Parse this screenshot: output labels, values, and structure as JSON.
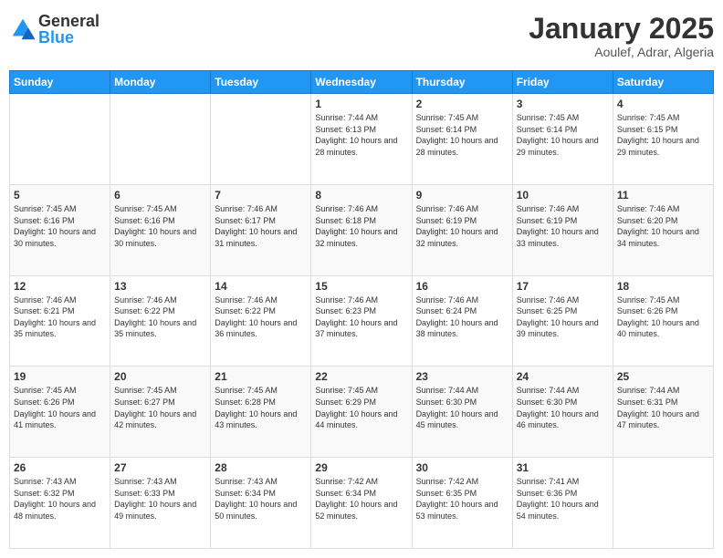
{
  "header": {
    "logo_general": "General",
    "logo_blue": "Blue",
    "month_title": "January 2025",
    "subtitle": "Aoulef, Adrar, Algeria"
  },
  "weekdays": [
    "Sunday",
    "Monday",
    "Tuesday",
    "Wednesday",
    "Thursday",
    "Friday",
    "Saturday"
  ],
  "weeks": [
    [
      {
        "day": "",
        "sunrise": "",
        "sunset": "",
        "daylight": ""
      },
      {
        "day": "",
        "sunrise": "",
        "sunset": "",
        "daylight": ""
      },
      {
        "day": "",
        "sunrise": "",
        "sunset": "",
        "daylight": ""
      },
      {
        "day": "1",
        "sunrise": "Sunrise: 7:44 AM",
        "sunset": "Sunset: 6:13 PM",
        "daylight": "Daylight: 10 hours and 28 minutes."
      },
      {
        "day": "2",
        "sunrise": "Sunrise: 7:45 AM",
        "sunset": "Sunset: 6:14 PM",
        "daylight": "Daylight: 10 hours and 28 minutes."
      },
      {
        "day": "3",
        "sunrise": "Sunrise: 7:45 AM",
        "sunset": "Sunset: 6:14 PM",
        "daylight": "Daylight: 10 hours and 29 minutes."
      },
      {
        "day": "4",
        "sunrise": "Sunrise: 7:45 AM",
        "sunset": "Sunset: 6:15 PM",
        "daylight": "Daylight: 10 hours and 29 minutes."
      }
    ],
    [
      {
        "day": "5",
        "sunrise": "Sunrise: 7:45 AM",
        "sunset": "Sunset: 6:16 PM",
        "daylight": "Daylight: 10 hours and 30 minutes."
      },
      {
        "day": "6",
        "sunrise": "Sunrise: 7:45 AM",
        "sunset": "Sunset: 6:16 PM",
        "daylight": "Daylight: 10 hours and 30 minutes."
      },
      {
        "day": "7",
        "sunrise": "Sunrise: 7:46 AM",
        "sunset": "Sunset: 6:17 PM",
        "daylight": "Daylight: 10 hours and 31 minutes."
      },
      {
        "day": "8",
        "sunrise": "Sunrise: 7:46 AM",
        "sunset": "Sunset: 6:18 PM",
        "daylight": "Daylight: 10 hours and 32 minutes."
      },
      {
        "day": "9",
        "sunrise": "Sunrise: 7:46 AM",
        "sunset": "Sunset: 6:19 PM",
        "daylight": "Daylight: 10 hours and 32 minutes."
      },
      {
        "day": "10",
        "sunrise": "Sunrise: 7:46 AM",
        "sunset": "Sunset: 6:19 PM",
        "daylight": "Daylight: 10 hours and 33 minutes."
      },
      {
        "day": "11",
        "sunrise": "Sunrise: 7:46 AM",
        "sunset": "Sunset: 6:20 PM",
        "daylight": "Daylight: 10 hours and 34 minutes."
      }
    ],
    [
      {
        "day": "12",
        "sunrise": "Sunrise: 7:46 AM",
        "sunset": "Sunset: 6:21 PM",
        "daylight": "Daylight: 10 hours and 35 minutes."
      },
      {
        "day": "13",
        "sunrise": "Sunrise: 7:46 AM",
        "sunset": "Sunset: 6:22 PM",
        "daylight": "Daylight: 10 hours and 35 minutes."
      },
      {
        "day": "14",
        "sunrise": "Sunrise: 7:46 AM",
        "sunset": "Sunset: 6:22 PM",
        "daylight": "Daylight: 10 hours and 36 minutes."
      },
      {
        "day": "15",
        "sunrise": "Sunrise: 7:46 AM",
        "sunset": "Sunset: 6:23 PM",
        "daylight": "Daylight: 10 hours and 37 minutes."
      },
      {
        "day": "16",
        "sunrise": "Sunrise: 7:46 AM",
        "sunset": "Sunset: 6:24 PM",
        "daylight": "Daylight: 10 hours and 38 minutes."
      },
      {
        "day": "17",
        "sunrise": "Sunrise: 7:46 AM",
        "sunset": "Sunset: 6:25 PM",
        "daylight": "Daylight: 10 hours and 39 minutes."
      },
      {
        "day": "18",
        "sunrise": "Sunrise: 7:45 AM",
        "sunset": "Sunset: 6:26 PM",
        "daylight": "Daylight: 10 hours and 40 minutes."
      }
    ],
    [
      {
        "day": "19",
        "sunrise": "Sunrise: 7:45 AM",
        "sunset": "Sunset: 6:26 PM",
        "daylight": "Daylight: 10 hours and 41 minutes."
      },
      {
        "day": "20",
        "sunrise": "Sunrise: 7:45 AM",
        "sunset": "Sunset: 6:27 PM",
        "daylight": "Daylight: 10 hours and 42 minutes."
      },
      {
        "day": "21",
        "sunrise": "Sunrise: 7:45 AM",
        "sunset": "Sunset: 6:28 PM",
        "daylight": "Daylight: 10 hours and 43 minutes."
      },
      {
        "day": "22",
        "sunrise": "Sunrise: 7:45 AM",
        "sunset": "Sunset: 6:29 PM",
        "daylight": "Daylight: 10 hours and 44 minutes."
      },
      {
        "day": "23",
        "sunrise": "Sunrise: 7:44 AM",
        "sunset": "Sunset: 6:30 PM",
        "daylight": "Daylight: 10 hours and 45 minutes."
      },
      {
        "day": "24",
        "sunrise": "Sunrise: 7:44 AM",
        "sunset": "Sunset: 6:30 PM",
        "daylight": "Daylight: 10 hours and 46 minutes."
      },
      {
        "day": "25",
        "sunrise": "Sunrise: 7:44 AM",
        "sunset": "Sunset: 6:31 PM",
        "daylight": "Daylight: 10 hours and 47 minutes."
      }
    ],
    [
      {
        "day": "26",
        "sunrise": "Sunrise: 7:43 AM",
        "sunset": "Sunset: 6:32 PM",
        "daylight": "Daylight: 10 hours and 48 minutes."
      },
      {
        "day": "27",
        "sunrise": "Sunrise: 7:43 AM",
        "sunset": "Sunset: 6:33 PM",
        "daylight": "Daylight: 10 hours and 49 minutes."
      },
      {
        "day": "28",
        "sunrise": "Sunrise: 7:43 AM",
        "sunset": "Sunset: 6:34 PM",
        "daylight": "Daylight: 10 hours and 50 minutes."
      },
      {
        "day": "29",
        "sunrise": "Sunrise: 7:42 AM",
        "sunset": "Sunset: 6:34 PM",
        "daylight": "Daylight: 10 hours and 52 minutes."
      },
      {
        "day": "30",
        "sunrise": "Sunrise: 7:42 AM",
        "sunset": "Sunset: 6:35 PM",
        "daylight": "Daylight: 10 hours and 53 minutes."
      },
      {
        "day": "31",
        "sunrise": "Sunrise: 7:41 AM",
        "sunset": "Sunset: 6:36 PM",
        "daylight": "Daylight: 10 hours and 54 minutes."
      },
      {
        "day": "",
        "sunrise": "",
        "sunset": "",
        "daylight": ""
      }
    ]
  ]
}
